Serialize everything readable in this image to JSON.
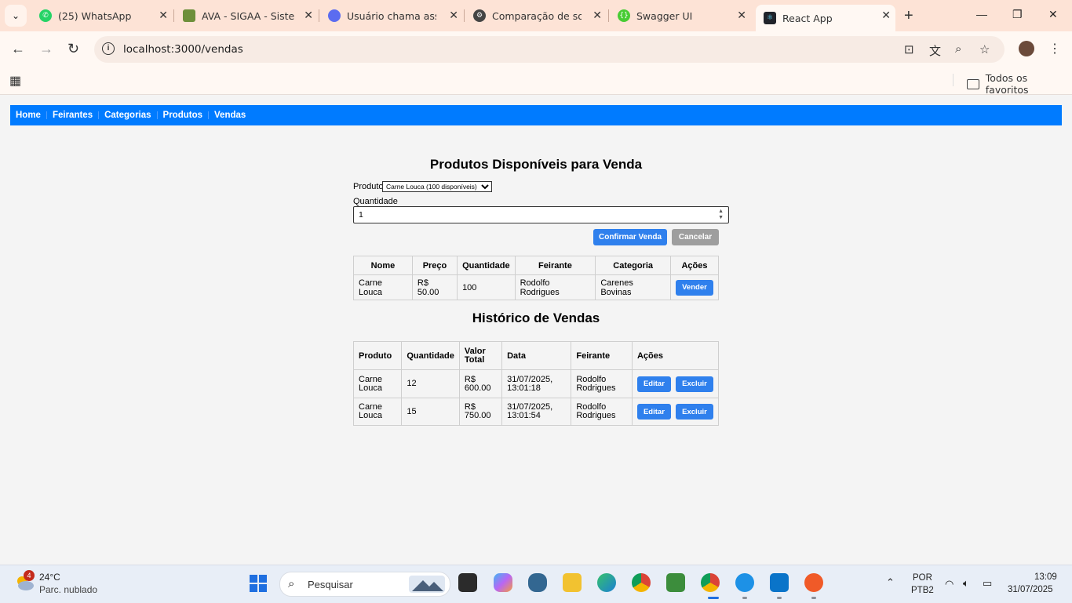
{
  "browser": {
    "tabs": [
      {
        "title": "(25) WhatsApp",
        "icon": "whatsapp-icon"
      },
      {
        "title": "AVA - SIGAA - Sistem",
        "icon": "sigaa-icon"
      },
      {
        "title": "Usuário chama assiste",
        "icon": "copilot-icon"
      },
      {
        "title": "Comparação de solu",
        "icon": "chatgpt-icon"
      },
      {
        "title": "Swagger UI",
        "icon": "swagger-icon"
      },
      {
        "title": "React App",
        "icon": "react-icon"
      }
    ],
    "url": "localhost:3000/vendas",
    "bookmarks_folder": "Todos os favoritos"
  },
  "nav": {
    "items": [
      "Home",
      "Feirantes",
      "Categorias",
      "Produtos",
      "Vendas"
    ]
  },
  "form": {
    "heading": "Produtos Disponíveis para Venda",
    "product_label": "Produto",
    "product_selected": "Carne Louca (100 disponíveis)",
    "quantity_label": "Quantidade",
    "quantity_value": "1",
    "confirm_label": "Confirmar Venda",
    "cancel_label": "Cancelar"
  },
  "products_table": {
    "headers": [
      "Nome",
      "Preço",
      "Quantidade",
      "Feirante",
      "Categoria",
      "Ações"
    ],
    "rows": [
      {
        "nome": "Carne Louca",
        "preco": "R$ 50.00",
        "quantidade": "100",
        "feirante": "Rodolfo Rodrigues",
        "categoria": "Carenes Bovinas",
        "action": "Vender"
      }
    ]
  },
  "history": {
    "heading": "Histórico de Vendas",
    "headers": [
      "Produto",
      "Quantidade",
      "Valor Total",
      "Data",
      "Feirante",
      "Ações"
    ],
    "rows": [
      {
        "produto": "Carne Louca",
        "quantidade": "12",
        "valor": "R$ 600.00",
        "data": "31/07/2025, 13:01:18",
        "feirante": "Rodolfo Rodrigues",
        "edit": "Editar",
        "delete": "Excluir"
      },
      {
        "produto": "Carne Louca",
        "quantidade": "15",
        "valor": "R$ 750.00",
        "data": "31/07/2025, 13:01:54",
        "feirante": "Rodolfo Rodrigues",
        "edit": "Editar",
        "delete": "Excluir"
      }
    ]
  },
  "taskbar": {
    "weather_badge": "4",
    "temperature": "24°C",
    "weather_desc": "Parc. nublado",
    "search_placeholder": "Pesquisar",
    "lang_top": "POR",
    "lang_bottom": "PTB2",
    "time": "13:09",
    "date": "31/07/2025"
  },
  "colors": {
    "nav_bg": "#007bff",
    "primary_button": "#2f80ed",
    "secondary_button": "#9e9e9e",
    "page_bg": "#f4f4f4",
    "tabstrip_bg": "#fde3d6"
  }
}
